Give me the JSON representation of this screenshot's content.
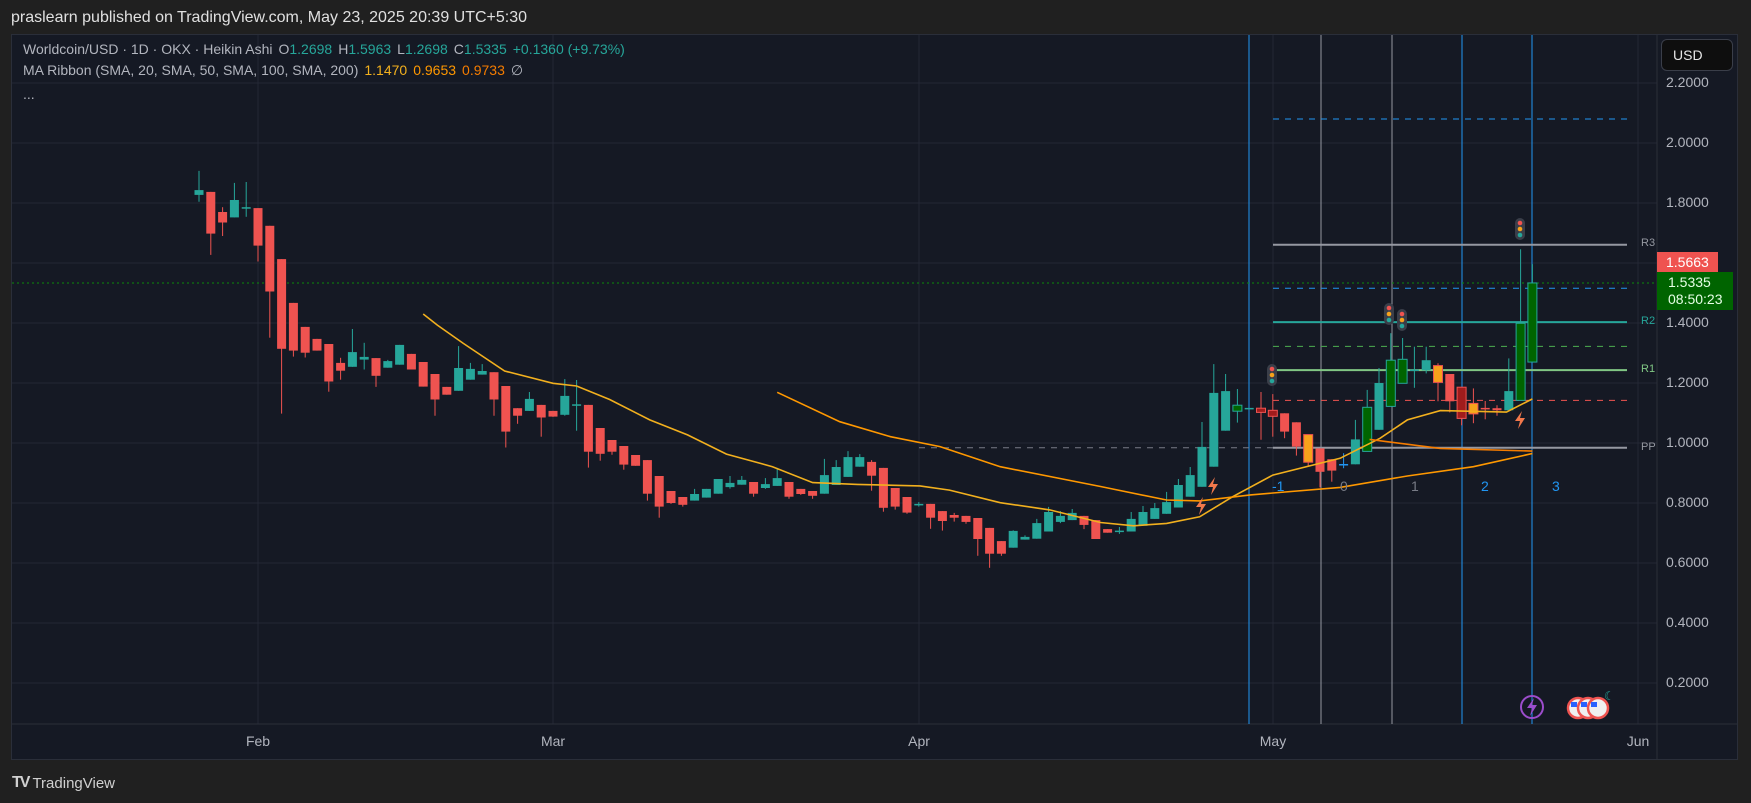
{
  "header": {
    "published": "praslearn published on TradingView.com, May 23, 2025 20:39 UTC+5:30"
  },
  "legend": {
    "symbol": "Worldcoin/USD · 1D · OKX · Heikin Ashi",
    "o_label": "O",
    "o": "1.2698",
    "h_label": "H",
    "h": "1.5963",
    "l_label": "L",
    "l": "1.2698",
    "c_label": "C",
    "c": "1.5335",
    "change": "+0.1360 (+9.73%)",
    "ma_title": "MA Ribbon (SMA, 20, SMA, 50, SMA, 100, SMA, 200)",
    "ma1": "1.1470",
    "ma2": "0.9653",
    "ma3": "0.9733",
    "ma4": "∅",
    "more": "..."
  },
  "currency_button": "USD",
  "last_price": {
    "high_marker": "1.5663",
    "price": "1.5335",
    "countdown": "08:50:23"
  },
  "pivots": {
    "r3": "R3",
    "r2": "R2",
    "r1": "R1",
    "pp": "PP"
  },
  "cycle_counts": [
    "-1",
    "0",
    "1",
    "2",
    "3"
  ],
  "branding": "TradingView",
  "colors": {
    "up": "#26a69a",
    "down": "#ef5350",
    "dark_up": "#006400",
    "dark_down": "#a01c1c",
    "orange": "#f7a21b",
    "ma20": "#f2b01e",
    "ma50": "#ff9800",
    "ma100": "#f57c00"
  },
  "chart_data": {
    "type": "candlestick",
    "title": "Worldcoin/USD · 1D · OKX · Heikin Ashi",
    "ylabel": "USD",
    "ylim": [
      0.1,
      2.3
    ],
    "y_ticks": [
      "2.2000",
      "2.0000",
      "1.8000",
      "1.4000",
      "1.2000",
      "1.0000",
      "0.8000",
      "0.6000",
      "0.4000",
      "0.2000"
    ],
    "x_ticks": [
      "Feb",
      "Mar",
      "Apr",
      "May",
      "Jun"
    ],
    "candle_fields": [
      "open",
      "high",
      "low",
      "close",
      "style"
    ],
    "candles": [
      [
        1.827,
        1.907,
        1.804,
        1.843,
        "g"
      ],
      [
        1.837,
        1.837,
        1.627,
        1.698,
        "r"
      ],
      [
        1.77,
        1.786,
        1.69,
        1.735,
        "r"
      ],
      [
        1.752,
        1.867,
        1.752,
        1.81,
        "g"
      ],
      [
        1.782,
        1.87,
        1.754,
        1.786,
        "g"
      ],
      [
        1.783,
        1.783,
        1.605,
        1.658,
        "r"
      ],
      [
        1.724,
        1.724,
        1.351,
        1.505,
        "r"
      ],
      [
        1.613,
        1.613,
        1.098,
        1.314,
        "r"
      ],
      [
        1.467,
        1.467,
        1.288,
        1.308,
        "r"
      ],
      [
        1.387,
        1.387,
        1.285,
        1.301,
        "r"
      ],
      [
        1.347,
        1.347,
        1.308,
        1.308,
        "r"
      ],
      [
        1.33,
        1.33,
        1.171,
        1.205,
        "r"
      ],
      [
        1.267,
        1.284,
        1.211,
        1.241,
        "r"
      ],
      [
        1.254,
        1.38,
        1.254,
        1.303,
        "g"
      ],
      [
        1.278,
        1.334,
        1.245,
        1.287,
        "g"
      ],
      [
        1.283,
        1.283,
        1.187,
        1.224,
        "r"
      ],
      [
        1.251,
        1.277,
        1.251,
        1.273,
        "g"
      ],
      [
        1.261,
        1.327,
        1.261,
        1.327,
        "g"
      ],
      [
        1.297,
        1.297,
        1.245,
        1.245,
        "r"
      ],
      [
        1.27,
        1.27,
        1.188,
        1.188,
        "r"
      ],
      [
        1.23,
        1.23,
        1.091,
        1.145,
        "r"
      ],
      [
        1.187,
        1.187,
        1.161,
        1.161,
        "r"
      ],
      [
        1.174,
        1.323,
        1.174,
        1.25,
        "g"
      ],
      [
        1.211,
        1.267,
        1.211,
        1.247,
        "g"
      ],
      [
        1.228,
        1.263,
        1.228,
        1.24,
        "g"
      ],
      [
        1.236,
        1.236,
        1.091,
        1.145,
        "r"
      ],
      [
        1.19,
        1.19,
        0.985,
        1.038,
        "r"
      ],
      [
        1.116,
        1.116,
        1.064,
        1.091,
        "r"
      ],
      [
        1.107,
        1.17,
        1.107,
        1.147,
        "g"
      ],
      [
        1.127,
        1.127,
        1.021,
        1.085,
        "r"
      ],
      [
        1.107,
        1.107,
        1.087,
        1.088,
        "r"
      ],
      [
        1.094,
        1.213,
        1.091,
        1.157,
        "g"
      ],
      [
        1.129,
        1.21,
        1.041,
        1.129,
        "g"
      ],
      [
        1.127,
        1.127,
        0.918,
        0.971,
        "r"
      ],
      [
        1.05,
        1.05,
        0.941,
        0.964,
        "r"
      ],
      [
        1.01,
        1.01,
        0.961,
        0.971,
        "r"
      ],
      [
        0.99,
        0.99,
        0.911,
        0.928,
        "r"
      ],
      [
        0.96,
        0.96,
        0.924,
        0.924,
        "r"
      ],
      [
        0.943,
        0.943,
        0.808,
        0.831,
        "r"
      ],
      [
        0.89,
        0.89,
        0.751,
        0.788,
        "r"
      ],
      [
        0.84,
        0.84,
        0.797,
        0.8,
        "r"
      ],
      [
        0.82,
        0.82,
        0.788,
        0.794,
        "r"
      ],
      [
        0.808,
        0.847,
        0.808,
        0.83,
        "g"
      ],
      [
        0.818,
        0.847,
        0.818,
        0.847,
        "g"
      ],
      [
        0.831,
        0.88,
        0.831,
        0.88,
        "g"
      ],
      [
        0.853,
        0.89,
        0.848,
        0.867,
        "g"
      ],
      [
        0.861,
        0.89,
        0.861,
        0.877,
        "g"
      ],
      [
        0.87,
        0.87,
        0.821,
        0.831,
        "r"
      ],
      [
        0.85,
        0.883,
        0.847,
        0.863,
        "g"
      ],
      [
        0.857,
        0.917,
        0.857,
        0.883,
        "g"
      ],
      [
        0.87,
        0.87,
        0.814,
        0.821,
        "r"
      ],
      [
        0.847,
        0.847,
        0.827,
        0.83,
        "r"
      ],
      [
        0.84,
        0.84,
        0.814,
        0.824,
        "r"
      ],
      [
        0.831,
        0.947,
        0.831,
        0.893,
        "g"
      ],
      [
        0.86,
        0.943,
        0.86,
        0.92,
        "g"
      ],
      [
        0.887,
        0.973,
        0.887,
        0.953,
        "g"
      ],
      [
        0.921,
        0.963,
        0.921,
        0.953,
        "g"
      ],
      [
        0.937,
        0.943,
        0.841,
        0.891,
        "r"
      ],
      [
        0.917,
        0.917,
        0.771,
        0.784,
        "r"
      ],
      [
        0.85,
        0.85,
        0.778,
        0.788,
        "r"
      ],
      [
        0.82,
        0.82,
        0.764,
        0.768,
        "r"
      ],
      [
        0.796,
        0.803,
        0.788,
        0.797,
        "g"
      ],
      [
        0.797,
        0.797,
        0.714,
        0.751,
        "r"
      ],
      [
        0.773,
        0.773,
        0.708,
        0.74,
        "r"
      ],
      [
        0.76,
        0.767,
        0.738,
        0.751,
        "r"
      ],
      [
        0.757,
        0.757,
        0.731,
        0.737,
        "r"
      ],
      [
        0.75,
        0.75,
        0.624,
        0.68,
        "r"
      ],
      [
        0.717,
        0.717,
        0.584,
        0.631,
        "r"
      ],
      [
        0.673,
        0.673,
        0.624,
        0.631,
        "r"
      ],
      [
        0.651,
        0.709,
        0.651,
        0.707,
        "g"
      ],
      [
        0.678,
        0.692,
        0.678,
        0.687,
        "g"
      ],
      [
        0.681,
        0.747,
        0.681,
        0.733,
        "g"
      ],
      [
        0.705,
        0.787,
        0.705,
        0.77,
        "g"
      ],
      [
        0.737,
        0.773,
        0.733,
        0.757,
        "g"
      ],
      [
        0.743,
        0.78,
        0.743,
        0.767,
        "g"
      ],
      [
        0.757,
        0.757,
        0.713,
        0.727,
        "r"
      ],
      [
        0.743,
        0.743,
        0.68,
        0.68,
        "r"
      ],
      [
        0.713,
        0.713,
        0.701,
        0.701,
        "r"
      ],
      [
        0.706,
        0.72,
        0.697,
        0.708,
        "g"
      ],
      [
        0.705,
        0.77,
        0.705,
        0.747,
        "g"
      ],
      [
        0.724,
        0.79,
        0.724,
        0.77,
        "g"
      ],
      [
        0.747,
        0.8,
        0.747,
        0.783,
        "g"
      ],
      [
        0.764,
        0.837,
        0.764,
        0.803,
        "g"
      ],
      [
        0.785,
        0.88,
        0.785,
        0.86,
        "g"
      ],
      [
        0.821,
        0.92,
        0.821,
        0.893,
        "g"
      ],
      [
        0.854,
        1.07,
        0.854,
        0.987,
        "g"
      ],
      [
        0.921,
        1.263,
        0.921,
        1.167,
        "g"
      ],
      [
        1.041,
        1.23,
        1.041,
        1.173,
        "g"
      ],
      [
        1.106,
        1.18,
        1.068,
        1.126,
        "dg"
      ],
      [
        1.115,
        1.116,
        1.115,
        1.117,
        "g"
      ],
      [
        1.116,
        1.17,
        1.011,
        1.102,
        "dr"
      ],
      [
        1.109,
        1.163,
        1.021,
        1.089,
        "dr"
      ],
      [
        1.099,
        1.099,
        1.016,
        1.038,
        "r"
      ],
      [
        1.069,
        1.069,
        0.958,
        0.988,
        "r"
      ],
      [
        1.028,
        1.028,
        0.924,
        0.936,
        "or"
      ],
      [
        0.982,
        0.982,
        0.852,
        0.904,
        "r"
      ],
      [
        0.946,
        0.946,
        0.871,
        0.908,
        "r"
      ],
      [
        0.928,
        0.966,
        0.916,
        0.93,
        "b"
      ],
      [
        0.929,
        1.077,
        0.929,
        1.012,
        "g"
      ],
      [
        0.972,
        1.177,
        0.972,
        1.119,
        "dg"
      ],
      [
        1.044,
        1.25,
        1.044,
        1.2,
        "g"
      ],
      [
        1.122,
        1.366,
        1.122,
        1.276,
        "dg"
      ],
      [
        1.199,
        1.35,
        1.199,
        1.279,
        "dg"
      ],
      [
        1.243,
        1.321,
        1.184,
        1.245,
        "g"
      ],
      [
        1.242,
        1.321,
        1.232,
        1.276,
        "g"
      ],
      [
        1.258,
        1.266,
        1.139,
        1.202,
        "or"
      ],
      [
        1.23,
        1.23,
        1.102,
        1.139,
        "r"
      ],
      [
        1.186,
        1.186,
        1.059,
        1.082,
        "dr"
      ],
      [
        1.132,
        1.182,
        1.066,
        1.097,
        "or"
      ],
      [
        1.116,
        1.14,
        1.079,
        1.117,
        "r"
      ],
      [
        1.116,
        1.126,
        1.091,
        1.109,
        "r"
      ],
      [
        1.109,
        1.282,
        1.109,
        1.173,
        "g"
      ],
      [
        1.142,
        1.646,
        1.142,
        1.399,
        "dg"
      ],
      [
        1.2698,
        1.5963,
        1.2698,
        1.5335,
        "dg"
      ]
    ],
    "moving_averages": [
      {
        "name": "SMA 20",
        "value": "1.1470",
        "points": [
          [
            19,
            1.43
          ],
          [
            20.2,
            1.393
          ],
          [
            22.4,
            1.332
          ],
          [
            25.9,
            1.24
          ],
          [
            30,
            1.199
          ],
          [
            32,
            1.19
          ],
          [
            34.8,
            1.145
          ],
          [
            38.2,
            1.077
          ],
          [
            41.4,
            1.027
          ],
          [
            44.7,
            0.963
          ],
          [
            48.6,
            0.921
          ],
          [
            52,
            0.868
          ],
          [
            55.8,
            0.862
          ],
          [
            61.1,
            0.857
          ],
          [
            63.6,
            0.843
          ],
          [
            67.9,
            0.801
          ],
          [
            72.1,
            0.777
          ],
          [
            76.4,
            0.735
          ],
          [
            79.2,
            0.724
          ],
          [
            82,
            0.732
          ],
          [
            84.8,
            0.754
          ],
          [
            87.6,
            0.821
          ],
          [
            91,
            0.893
          ],
          [
            96.7,
            0.949
          ],
          [
            100.1,
            1.016
          ],
          [
            102.4,
            1.077
          ],
          [
            105.2,
            1.108
          ],
          [
            110.8,
            1.103
          ],
          [
            113,
            1.147
          ]
        ]
      },
      {
        "name": "SMA 50",
        "value": "0.9653",
        "points": [
          [
            49,
            1.169
          ],
          [
            54.3,
            1.071
          ],
          [
            58.6,
            1.021
          ],
          [
            62.8,
            0.988
          ],
          [
            67.9,
            0.921
          ],
          [
            76.4,
            0.855
          ],
          [
            82,
            0.81
          ],
          [
            84.8,
            0.807
          ],
          [
            89.1,
            0.827
          ],
          [
            96.7,
            0.852
          ],
          [
            102.4,
            0.89
          ],
          [
            108,
            0.921
          ],
          [
            113,
            0.965
          ]
        ]
      },
      {
        "name": "SMA 100",
        "value": "0.9733",
        "points": [
          [
            99.2,
            1.012
          ],
          [
            105.2,
            0.982
          ],
          [
            113,
            0.973
          ]
        ]
      }
    ],
    "pivot_levels": {
      "R3": 1.661,
      "R2": 1.403,
      "R1": 1.243,
      "PP": 0.984,
      "mid_levels": [
        2.08,
        1.516,
        1.322,
        1.142
      ]
    },
    "current_price": 1.5335
  }
}
